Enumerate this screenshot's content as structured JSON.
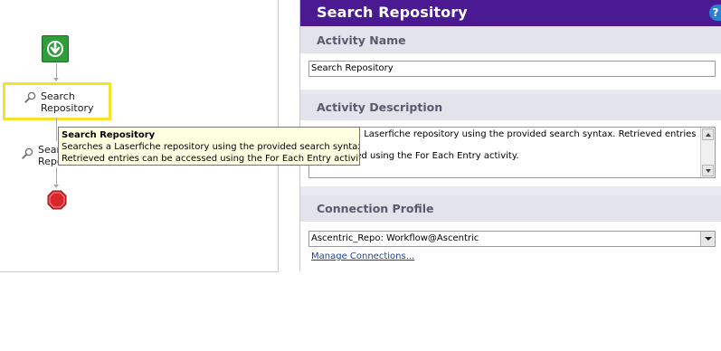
{
  "designer": {
    "activities": [
      {
        "label": "Search\nRepository",
        "icon": "magnifier-icon",
        "selected": true
      },
      {
        "label": "Search\nRepository",
        "icon": "magnifier-icon",
        "selected": false
      }
    ],
    "start_icon": "green-down-arrow-icon",
    "end_icon": "red-stop-octagon-icon"
  },
  "tooltip": {
    "title": "Search Repository",
    "line1": "Searches a Laserfiche repository using the provided search syntax.",
    "line2": "Retrieved entries can be accessed using the For Each Entry activity."
  },
  "panel": {
    "title": "Search Repository",
    "help_icon": "?",
    "activity_name": {
      "label": "Activity Name",
      "value": "Search Repository"
    },
    "activity_description": {
      "label": "Activity Description",
      "value": "Searches a Laserfiche repository using the provided search syntax.  Retrieved entries can\nbe accessed using the For Each Entry activity."
    },
    "connection_profile": {
      "label": "Connection Profile",
      "selected": "Ascentric_Repo: Workflow@Ascentric",
      "manage_link": "Manage Connections..."
    }
  },
  "colors": {
    "header_bg": "#4b1a93",
    "selection_border": "#f5e22b",
    "tooltip_bg": "#ffffe1",
    "link": "#1e3fa8"
  }
}
